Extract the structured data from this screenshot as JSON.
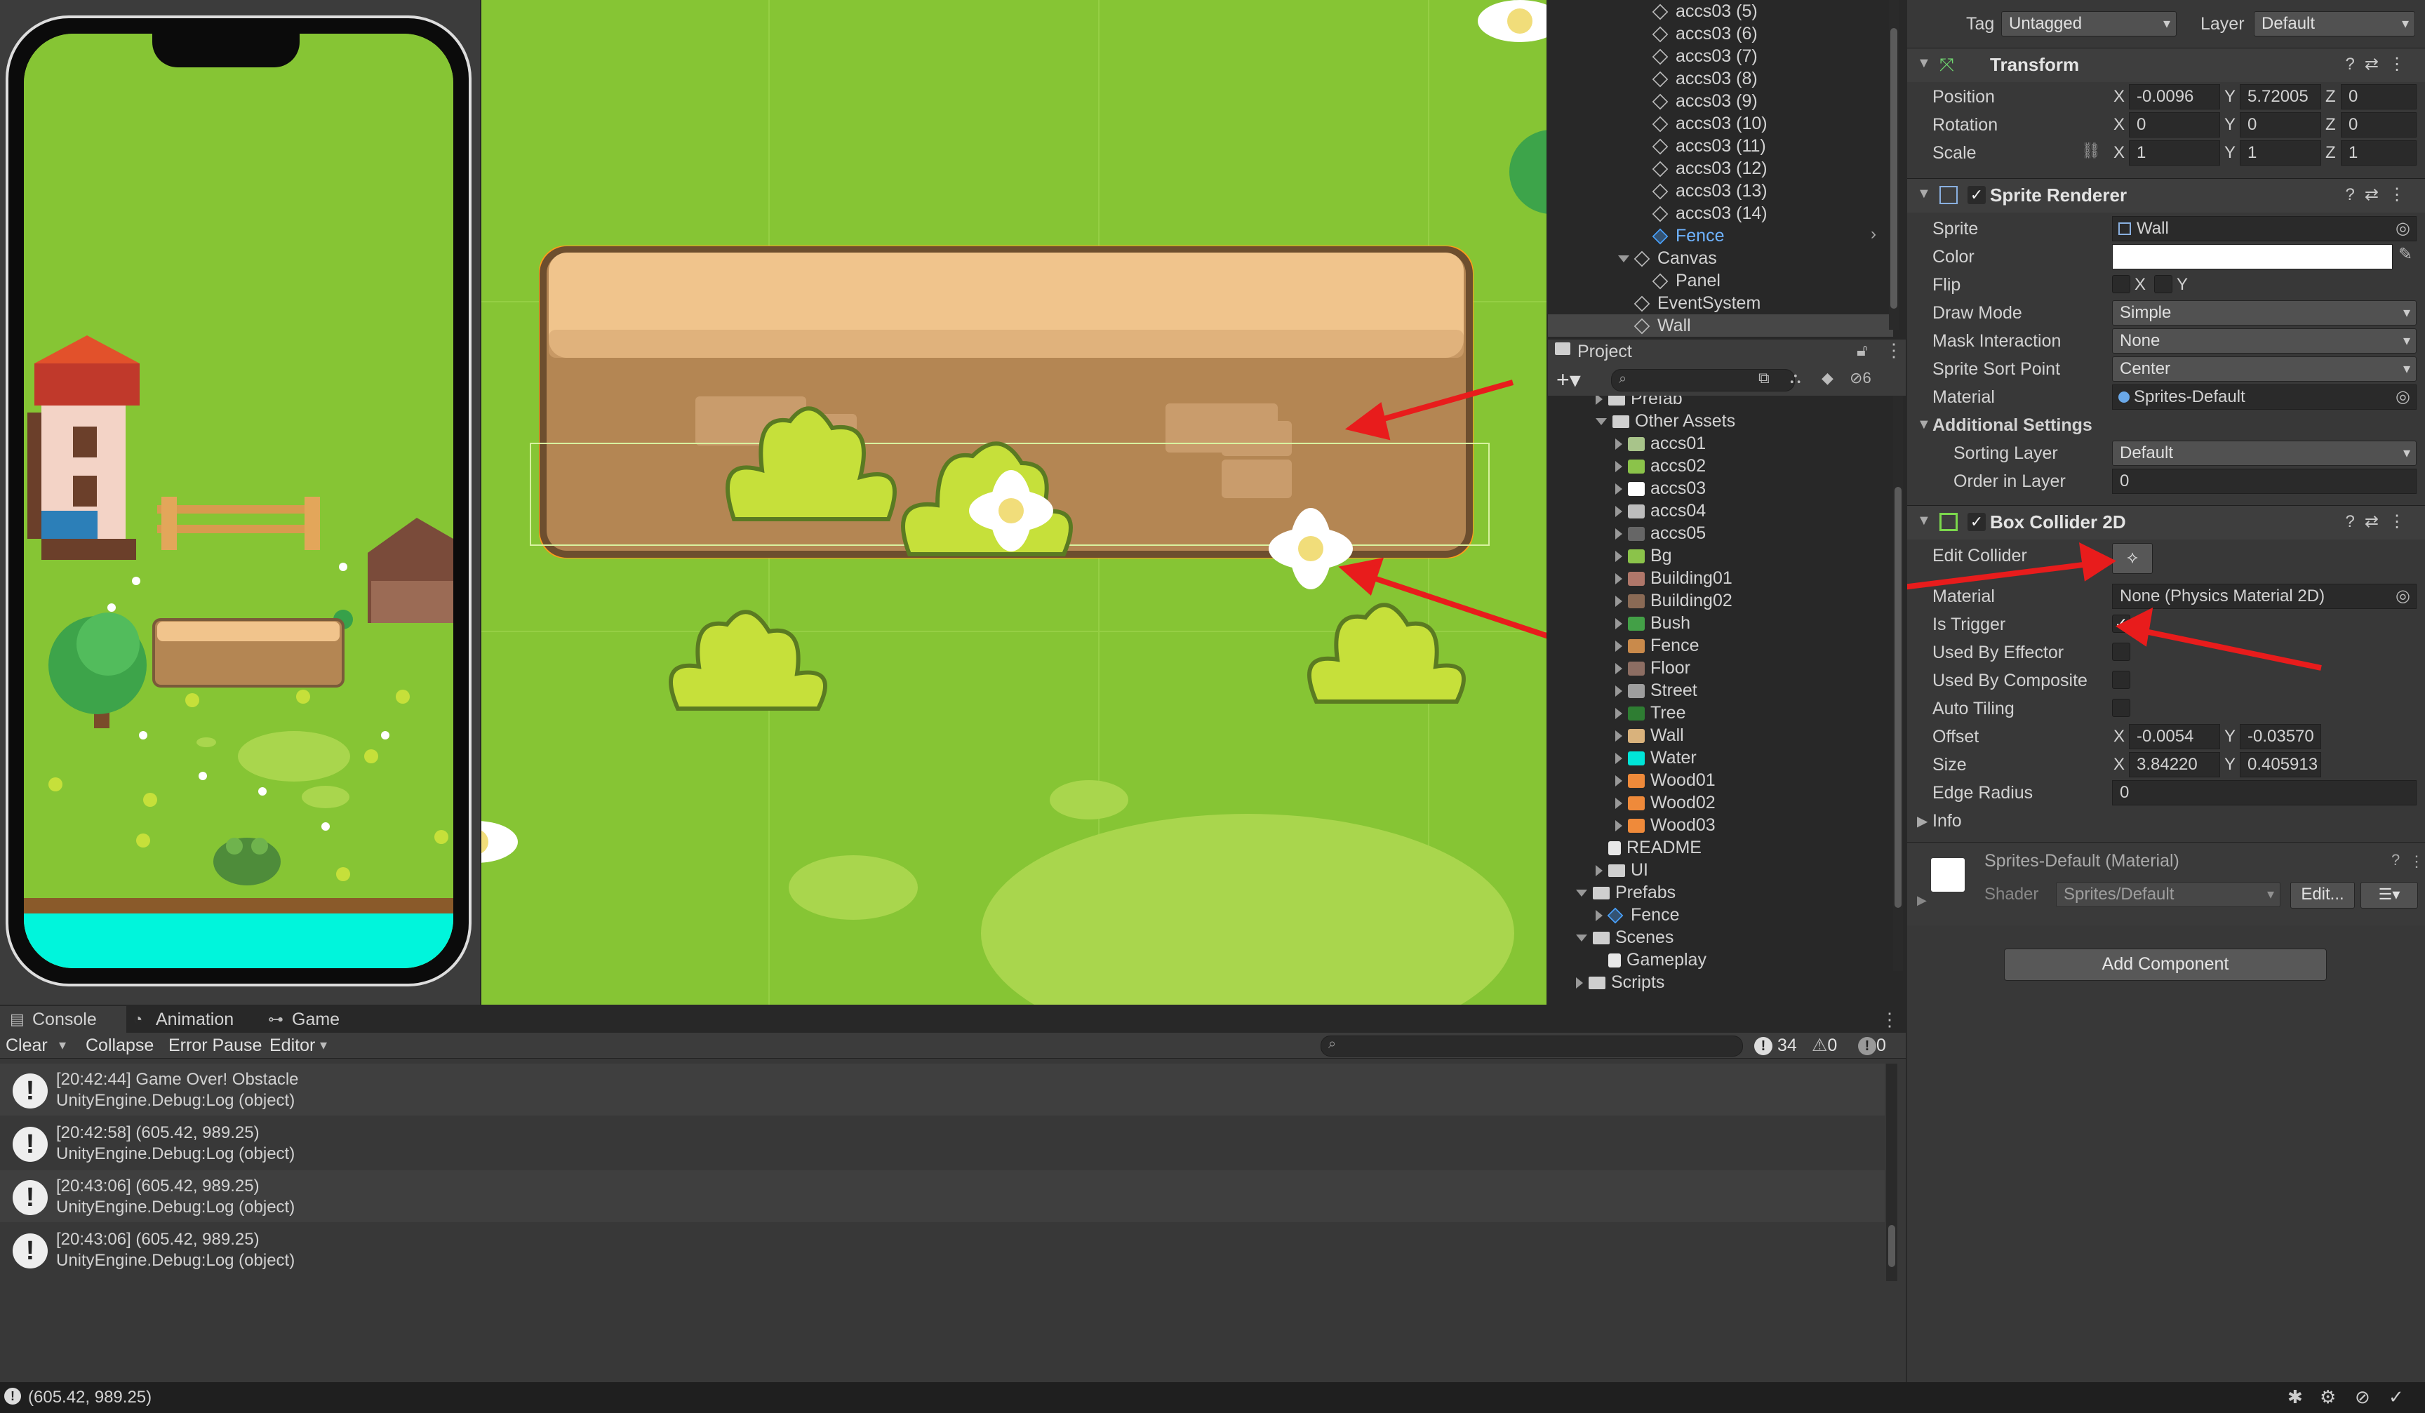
{
  "colors": {
    "accent_blue": "#4aa3ff",
    "annotation_red": "#e81c1c",
    "grass": "#86c534"
  },
  "hierarchy": {
    "items": [
      {
        "label": "accs03 (5)",
        "indent": 1
      },
      {
        "label": "accs03 (6)",
        "indent": 1
      },
      {
        "label": "accs03 (7)",
        "indent": 1
      },
      {
        "label": "accs03 (8)",
        "indent": 1
      },
      {
        "label": "accs03 (9)",
        "indent": 1
      },
      {
        "label": "accs03 (10)",
        "indent": 1
      },
      {
        "label": "accs03 (11)",
        "indent": 1
      },
      {
        "label": "accs03 (12)",
        "indent": 1
      },
      {
        "label": "accs03 (13)",
        "indent": 1
      },
      {
        "label": "accs03 (14)",
        "indent": 1
      },
      {
        "label": "Fence",
        "indent": 1,
        "prefab": true
      },
      {
        "label": "Canvas",
        "indent": 0,
        "expanded": true
      },
      {
        "label": "Panel",
        "indent": 1
      },
      {
        "label": "EventSystem",
        "indent": 0
      },
      {
        "label": "Wall",
        "indent": 0,
        "selected": true
      }
    ]
  },
  "project": {
    "tab_label": "Project",
    "hidden_count": "6",
    "items": [
      {
        "label": "Prefab",
        "type": "folder",
        "indent": 1
      },
      {
        "label": "Other Assets",
        "type": "folder",
        "indent": 1,
        "expanded": true
      },
      {
        "label": "accs01",
        "type": "sprite",
        "color": "#a8c48a",
        "indent": 2
      },
      {
        "label": "accs02",
        "type": "sprite",
        "color": "#8bc34a",
        "indent": 2
      },
      {
        "label": "accs03",
        "type": "sprite",
        "color": "#ffffff",
        "indent": 2
      },
      {
        "label": "accs04",
        "type": "sprite",
        "color": "#bdbdbd",
        "indent": 2
      },
      {
        "label": "accs05",
        "type": "sprite",
        "color": "#666666",
        "indent": 2
      },
      {
        "label": "Bg",
        "type": "sprite",
        "color": "#8bc34a",
        "indent": 2
      },
      {
        "label": "Building01",
        "type": "sprite",
        "color": "#b0776a",
        "indent": 2
      },
      {
        "label": "Building02",
        "type": "sprite",
        "color": "#8a6a55",
        "indent": 2
      },
      {
        "label": "Bush",
        "type": "sprite",
        "color": "#43a047",
        "indent": 2
      },
      {
        "label": "Fence",
        "type": "sprite",
        "color": "#c98a4b",
        "indent": 2
      },
      {
        "label": "Floor",
        "type": "sprite",
        "color": "#8d6e63",
        "indent": 2
      },
      {
        "label": "Street",
        "type": "sprite",
        "color": "#9e9e9e",
        "indent": 2
      },
      {
        "label": "Tree",
        "type": "sprite",
        "color": "#2e7d32",
        "indent": 2
      },
      {
        "label": "Wall",
        "type": "sprite",
        "color": "#d9b27c",
        "indent": 2
      },
      {
        "label": "Water",
        "type": "sprite",
        "color": "#00e5d8",
        "indent": 2
      },
      {
        "label": "Wood01",
        "type": "sprite",
        "color": "#ef8a3a",
        "indent": 2
      },
      {
        "label": "Wood02",
        "type": "sprite",
        "color": "#ef8a3a",
        "indent": 2
      },
      {
        "label": "Wood03",
        "type": "sprite",
        "color": "#ef8a3a",
        "indent": 2
      },
      {
        "label": "README",
        "type": "doc",
        "indent": 1
      },
      {
        "label": "UI",
        "type": "folder",
        "indent": 1
      },
      {
        "label": "Prefabs",
        "type": "folder",
        "indent": 0,
        "expanded": true
      },
      {
        "label": "Fence",
        "type": "prefab",
        "indent": 1
      },
      {
        "label": "Scenes",
        "type": "folder",
        "indent": 0,
        "expanded": true
      },
      {
        "label": "Gameplay",
        "type": "scene",
        "indent": 1
      },
      {
        "label": "Scripts",
        "type": "folder",
        "indent": 0
      }
    ]
  },
  "inspector": {
    "tag_label": "Tag",
    "tag_value": "Untagged",
    "layer_label": "Layer",
    "layer_value": "Default",
    "transform": {
      "title": "Transform",
      "position_label": "Position",
      "position": {
        "x": "-0.0096",
        "y": "5.72005",
        "z": "0"
      },
      "rotation_label": "Rotation",
      "rotation": {
        "x": "0",
        "y": "0",
        "z": "0"
      },
      "scale_label": "Scale",
      "scale": {
        "x": "1",
        "y": "1",
        "z": "1"
      }
    },
    "sprite_renderer": {
      "title": "Sprite Renderer",
      "sprite_label": "Sprite",
      "sprite_value": "Wall",
      "color_label": "Color",
      "flip_label": "Flip",
      "flip_x": "X",
      "flip_y": "Y",
      "draw_mode_label": "Draw Mode",
      "draw_mode_value": "Simple",
      "mask_label": "Mask Interaction",
      "mask_value": "None",
      "sort_point_label": "Sprite Sort Point",
      "sort_point_value": "Center",
      "material_label": "Material",
      "material_value": "Sprites-Default",
      "additional_label": "Additional Settings",
      "sorting_layer_label": "Sorting Layer",
      "sorting_layer_value": "Default",
      "order_label": "Order in Layer",
      "order_value": "0"
    },
    "box_collider": {
      "title": "Box Collider 2D",
      "edit_collider_label": "Edit Collider",
      "material_label": "Material",
      "material_value": "None (Physics Material 2D)",
      "is_trigger_label": "Is Trigger",
      "used_by_effector_label": "Used By Effector",
      "used_by_composite_label": "Used By Composite",
      "auto_tiling_label": "Auto Tiling",
      "offset_label": "Offset",
      "offset": {
        "x": "-0.0054",
        "y": "-0.03570"
      },
      "size_label": "Size",
      "size": {
        "x": "3.84220",
        "y": "0.405913"
      },
      "edge_radius_label": "Edge Radius",
      "edge_radius_value": "0",
      "info_label": "Info"
    },
    "material_preview": {
      "title": "Sprites-Default (Material)",
      "shader_label": "Shader",
      "shader_value": "Sprites/Default",
      "edit_label": "Edit..."
    },
    "add_component_label": "Add Component"
  },
  "console": {
    "tabs": [
      {
        "label": "Console"
      },
      {
        "label": "Animation"
      },
      {
        "label": "Game"
      }
    ],
    "toolbar": {
      "clear": "Clear",
      "collapse": "Collapse",
      "error_pause": "Error Pause",
      "editor": "Editor"
    },
    "counts": {
      "logs": "34",
      "warnings": "0",
      "errors": "0"
    },
    "logs": [
      {
        "line1": "[20:42:44] Game Over! Obstacle",
        "line2": "UnityEngine.Debug:Log (object)"
      },
      {
        "line1": "[20:42:58] (605.42, 989.25)",
        "line2": "UnityEngine.Debug:Log (object)"
      },
      {
        "line1": "[20:43:06] (605.42, 989.25)",
        "line2": "UnityEngine.Debug:Log (object)"
      },
      {
        "line1": "[20:43:06] (605.42, 989.25)",
        "line2": "UnityEngine.Debug:Log (object)"
      }
    ]
  },
  "status_bar": {
    "message": "(605.42, 989.25)"
  }
}
